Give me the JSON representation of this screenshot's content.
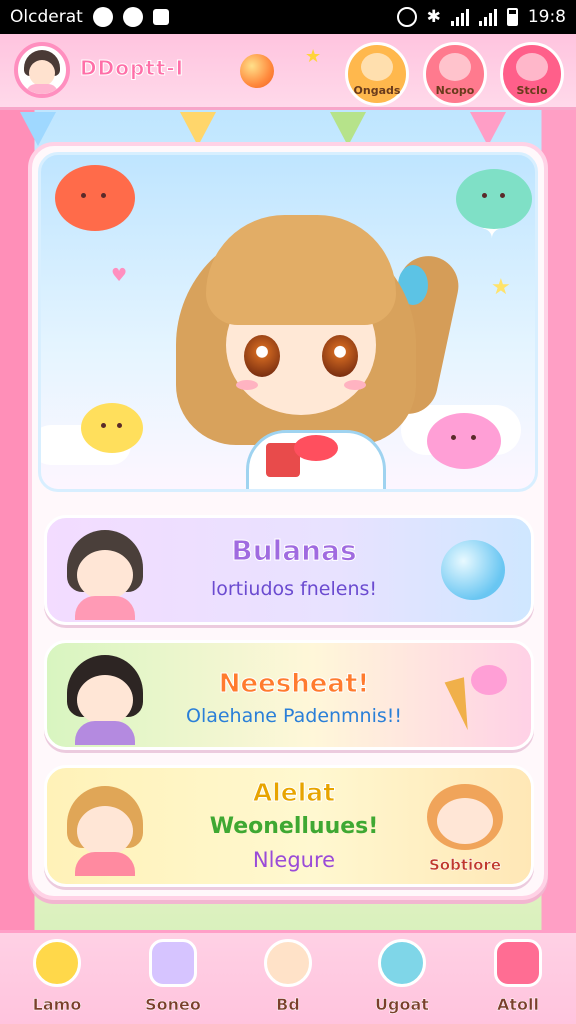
{
  "status_bar": {
    "carrier": "Olcderat",
    "time": "19:8"
  },
  "header": {
    "username": "DDoptt-I",
    "buttons": [
      {
        "label": "Ongads",
        "color": "#ffb84d"
      },
      {
        "label": "Ncopo",
        "color": "#ff7a8e"
      },
      {
        "label": "Stclo",
        "color": "#ff5f8a"
      }
    ]
  },
  "cards": [
    {
      "title": "Bulanas",
      "subtitle": "lortiudos fnelens!"
    },
    {
      "title": "Neesheat!",
      "subtitle": "Olaehane Padenmnis!!"
    },
    {
      "title": "Alelat",
      "subtitle": "Weonelluues!",
      "subtitle2": "Nlegure",
      "badge": "Sobtiore"
    }
  ],
  "bottom_nav": [
    {
      "label": "Lamo",
      "icon": "star-icon"
    },
    {
      "label": "Soneo",
      "icon": "cup-icon"
    },
    {
      "label": "Bd",
      "icon": "character-icon"
    },
    {
      "label": "Ugoat",
      "icon": "heart-gem-icon"
    },
    {
      "label": "Atoll",
      "icon": "shop-icon"
    }
  ],
  "colors": {
    "accent": "#ff8fbf",
    "header_bg": "#ffc4df",
    "panel_border": "#ffd2e6"
  }
}
